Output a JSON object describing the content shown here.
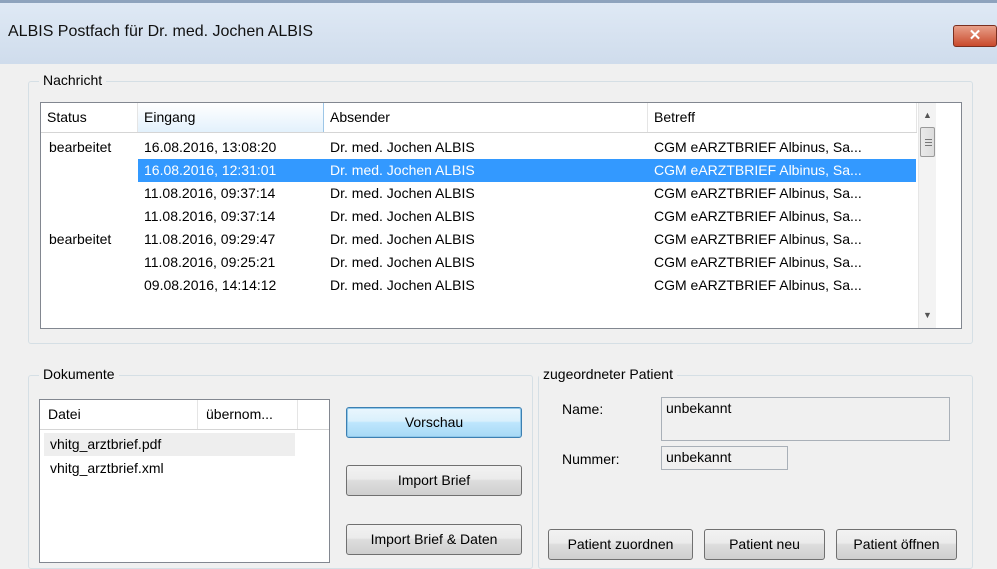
{
  "window": {
    "title": "ALBIS Postfach für Dr. med. Jochen ALBIS",
    "close_glyph": "✕"
  },
  "messages": {
    "group_label": "Nachricht",
    "columns": [
      "Status",
      "Eingang",
      "Absender",
      "Betreff"
    ],
    "sorted_column": "Eingang",
    "rows": [
      {
        "status": "bearbeitet",
        "eingang": "16.08.2016, 13:08:20",
        "absender": "Dr. med. Jochen ALBIS",
        "betreff": "CGM eARZTBRIEF Albinus, Sa...",
        "selected": false
      },
      {
        "status": "",
        "eingang": "16.08.2016, 12:31:01",
        "absender": "Dr. med. Jochen ALBIS",
        "betreff": "CGM eARZTBRIEF Albinus, Sa...",
        "selected": true
      },
      {
        "status": "",
        "eingang": "11.08.2016, 09:37:14",
        "absender": "Dr. med. Jochen ALBIS",
        "betreff": "CGM eARZTBRIEF Albinus, Sa...",
        "selected": false
      },
      {
        "status": "",
        "eingang": "11.08.2016, 09:37:14",
        "absender": "Dr. med. Jochen ALBIS",
        "betreff": "CGM eARZTBRIEF Albinus, Sa...",
        "selected": false
      },
      {
        "status": "bearbeitet",
        "eingang": "11.08.2016, 09:29:47",
        "absender": "Dr. med. Jochen ALBIS",
        "betreff": "CGM eARZTBRIEF Albinus, Sa...",
        "selected": false
      },
      {
        "status": "",
        "eingang": "11.08.2016, 09:25:21",
        "absender": "Dr. med. Jochen ALBIS",
        "betreff": "CGM eARZTBRIEF Albinus, Sa...",
        "selected": false
      },
      {
        "status": "",
        "eingang": "09.08.2016, 14:14:12",
        "absender": "Dr. med. Jochen ALBIS",
        "betreff": "CGM eARZTBRIEF Albinus, Sa...",
        "selected": false
      }
    ],
    "scroll_up_icon": "▲",
    "scroll_down_icon": "▼"
  },
  "documents": {
    "group_label": "Dokumente",
    "columns": [
      "Datei",
      "übernom..."
    ],
    "files": [
      {
        "name": "vhitg_arztbrief.pdf",
        "highlighted": true
      },
      {
        "name": "vhitg_arztbrief.xml",
        "highlighted": false
      }
    ],
    "buttons": {
      "preview": "Vorschau",
      "import_letter": "Import Brief",
      "import_letter_data": "Import Brief & Daten"
    }
  },
  "patient": {
    "group_label": "zugeordneter Patient",
    "name_label": "Name:",
    "name_value": "unbekannt",
    "number_label": "Nummer:",
    "number_value": "unbekannt",
    "buttons": {
      "assign": "Patient zuordnen",
      "new": "Patient neu",
      "open": "Patient öffnen"
    }
  }
}
